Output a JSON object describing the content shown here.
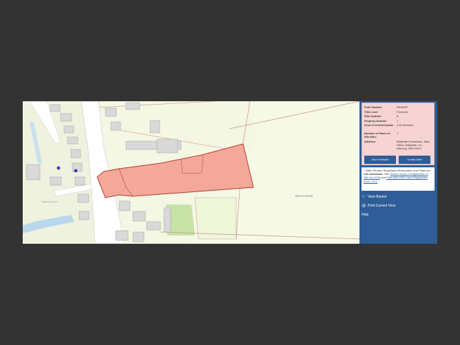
{
  "folio": {
    "rows": [
      {
        "label": "Folio Number",
        "value": "KK6302F"
      },
      {
        "label": "Title Level",
        "value": "Freehold"
      },
      {
        "label": "Plan Number",
        "value": "8"
      },
      {
        "label": "Property Number",
        "value": "1"
      },
      {
        "label": "Area of selected plans",
        "value": "0.40 hectares"
      },
      {
        "label": "Number of Plans on this folio:",
        "value": "1"
      },
      {
        "label": "Address",
        "value": "Ballyhale Foodstores, Main Street, Ballyhale, Co. Kilkenny, R95 PNP4"
      }
    ],
    "add_basket_label": "Add to Basket",
    "create_alert_label": "Create Alert"
  },
  "notice": {
    "p1": "**Tailte Éireann Registration Boundaries and Plans are ",
    "p1_bold": "not conclusive",
    "p2": ". See ",
    "link1": "Section 62(2) of Registration of Title Act 2006",
    "p3": " and ",
    "link2": "Rule 8(3) of the Land Registration Rules 2012",
    "p4": "."
  },
  "menu": {
    "view_basket": "View Basket",
    "print_view": "Print Current View",
    "help": "Help"
  },
  "map": {
    "area_label": "BALLYHALE",
    "church_label": "Ballyhale Church"
  },
  "colors": {
    "panel": "#2e5d97",
    "info_bg": "#f7d3d3",
    "parcel_fill": "#f4a89a",
    "parcel_stroke": "#b23a2e"
  }
}
